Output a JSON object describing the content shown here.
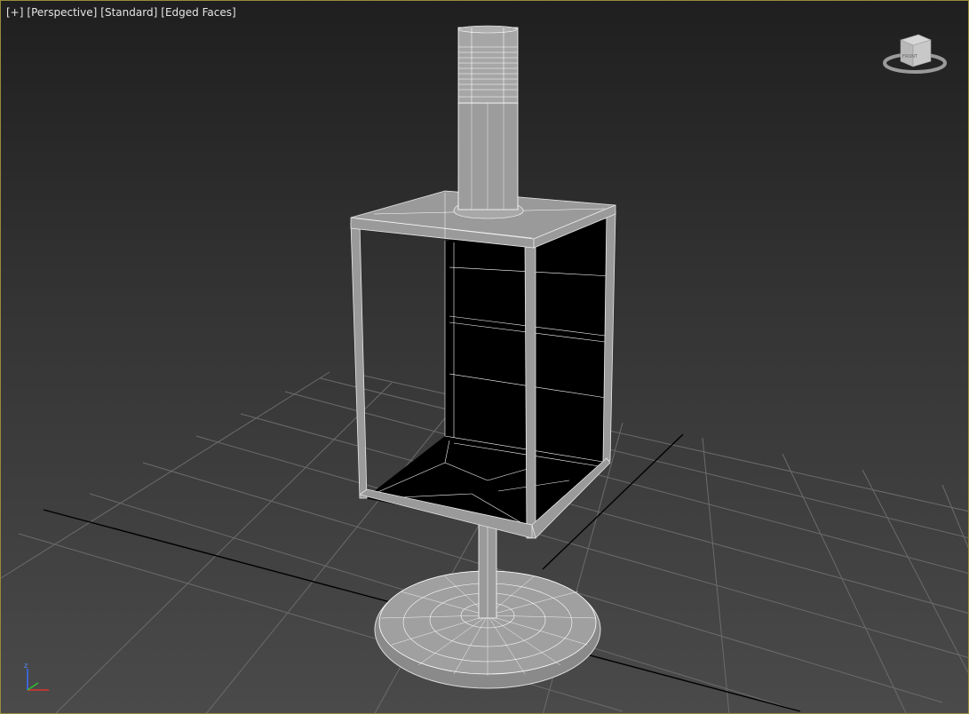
{
  "viewport": {
    "labels": {
      "plus": "[+]",
      "view": "[Perspective]",
      "shading": "[Standard]",
      "edges": "[Edged Faces]"
    },
    "viewcube_face_label": "FRONT",
    "axis_label_z": "z",
    "colors": {
      "border": "#9a8a3a",
      "bg_top": "#1f1f1f",
      "bg_bottom": "#4a4a4a",
      "grid": "#6b6b6b",
      "grid_axis": "#000000",
      "model_fill": "#9a9a9a",
      "model_wire": "#ffffff"
    }
  }
}
